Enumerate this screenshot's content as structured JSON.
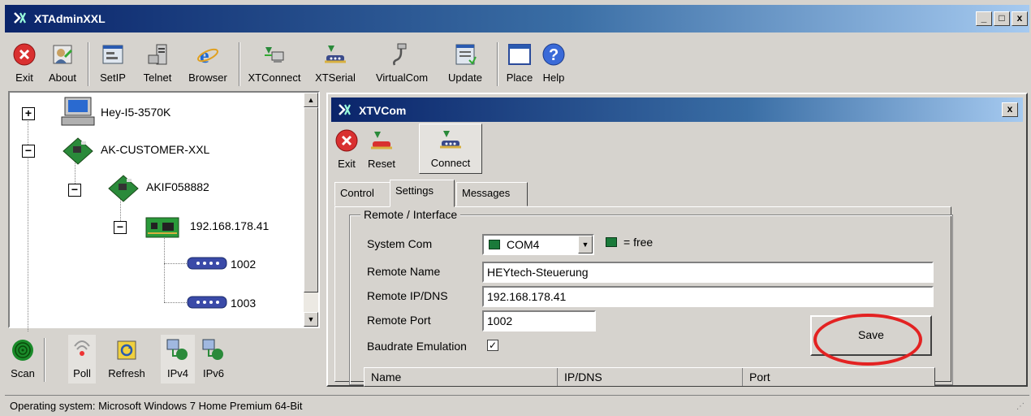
{
  "app": {
    "title": "XTAdminXXL",
    "caption_buttons": {
      "minimize": "_",
      "maximize": "□",
      "close": "x"
    }
  },
  "toolbar": {
    "items": [
      {
        "label": "Exit",
        "icon": "exit-icon"
      },
      {
        "label": "About",
        "icon": "about-icon"
      },
      {
        "label": "SetIP",
        "icon": "setip-icon"
      },
      {
        "label": "Telnet",
        "icon": "telnet-icon"
      },
      {
        "label": "Browser",
        "icon": "browser-icon"
      },
      {
        "label": "XTConnect",
        "icon": "xtconnect-icon"
      },
      {
        "label": "XTSerial",
        "icon": "xtserial-icon"
      },
      {
        "label": "VirtualCom",
        "icon": "virtualcom-icon"
      },
      {
        "label": "Update",
        "icon": "update-icon"
      },
      {
        "label": "Place",
        "icon": "place-icon"
      },
      {
        "label": "Help",
        "icon": "help-icon"
      }
    ]
  },
  "tree": {
    "nodes": [
      {
        "label": "Hey-I5-3570K",
        "expander": "+",
        "icon": "computer-icon"
      },
      {
        "label": "AK-CUSTOMER-XXL",
        "expander": "−",
        "icon": "network-board-icon"
      },
      {
        "label": "AKIF058882",
        "expander": "−",
        "icon": "network-board-icon"
      },
      {
        "label": "192.168.178.41",
        "expander": "−",
        "icon": "circuit-board-icon"
      },
      {
        "label": "1002",
        "icon": "serial-port-icon"
      },
      {
        "label": "1003",
        "icon": "serial-port-icon"
      }
    ]
  },
  "bottom_toolbar": {
    "items": [
      {
        "label": "Scan",
        "icon": "scan-icon"
      },
      {
        "label": "Poll",
        "icon": "poll-icon"
      },
      {
        "label": "Refresh",
        "icon": "refresh-icon"
      },
      {
        "label": "IPv4",
        "icon": "ipv4-icon"
      },
      {
        "label": "IPv6",
        "icon": "ipv6-icon"
      }
    ]
  },
  "status_bar": {
    "text": "Operating system:  Microsoft Windows 7 Home Premium  64-Bit"
  },
  "child": {
    "title": "XTVCom",
    "close": "x",
    "toolbar": [
      {
        "label": "Exit",
        "icon": "exit-icon"
      },
      {
        "label": "Reset",
        "icon": "reset-icon"
      },
      {
        "label": "Connect",
        "icon": "connect-icon"
      }
    ],
    "tabs": [
      {
        "label": "Control"
      },
      {
        "label": "Settings",
        "active": true
      },
      {
        "label": "Messages"
      }
    ],
    "group": {
      "title": "Remote / Interface",
      "system_com_label": "System Com",
      "system_com_value": "COM4",
      "system_com_status_color": "#1a7a3a",
      "free_legend": "= free",
      "remote_name_label": "Remote Name",
      "remote_name_value": "HEYtech-Steuerung",
      "remote_ip_label": "Remote IP/DNS",
      "remote_ip_value": "192.168.178.41",
      "remote_port_label": "Remote Port",
      "remote_port_value": "1002",
      "baudrate_label": "Baudrate Emulation",
      "baudrate_checked": true,
      "save_label": "Save"
    },
    "list_headers": [
      "Name",
      "IP/DNS",
      "Port"
    ]
  },
  "colors": {
    "accent_highlight": "#e32222",
    "titlebar_start": "#0a246a",
    "titlebar_end": "#a6caf0"
  }
}
